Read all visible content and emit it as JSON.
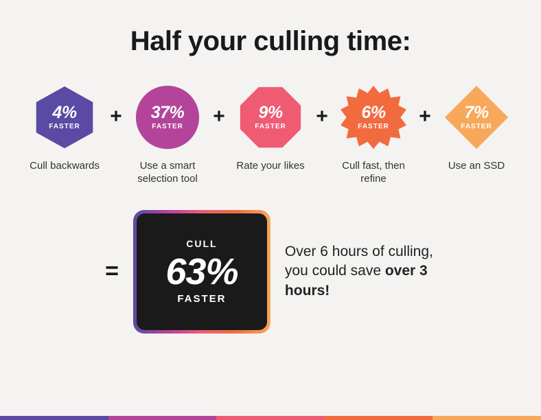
{
  "title": "Half your culling time:",
  "badges": [
    {
      "percent": "4%",
      "sub": "FASTER",
      "caption": "Cull backwards",
      "shape": "hexagon",
      "fill": "#5a4aa3"
    },
    {
      "percent": "37%",
      "sub": "FASTER",
      "caption": "Use a smart selection tool",
      "shape": "circle",
      "fill": "#b4449a"
    },
    {
      "percent": "9%",
      "sub": "FASTER",
      "caption": "Rate your likes",
      "shape": "octagon",
      "fill": "#ef5b72"
    },
    {
      "percent": "6%",
      "sub": "FASTER",
      "caption": "Cull fast, then refine",
      "shape": "burst",
      "fill": "#f26b3f"
    },
    {
      "percent": "7%",
      "sub": "FASTER",
      "caption": "Use an SSD",
      "shape": "diamond",
      "fill": "#f7a85a"
    }
  ],
  "plus": "+",
  "equals": "=",
  "result": {
    "top": "CULL",
    "percent": "63%",
    "bottom": "FASTER"
  },
  "summary": {
    "line1": "Over 6 hours of culling, you could save ",
    "bold": "over 3 hours!"
  },
  "stripe_colors": [
    "#5a4aa3",
    "#b4449a",
    "#ef5b72",
    "#f26b3f",
    "#f7a85a"
  ],
  "chart_data": {
    "type": "bar",
    "title": "Half your culling time:",
    "categories": [
      "Cull backwards",
      "Use a smart selection tool",
      "Rate your likes",
      "Cull fast, then refine",
      "Use an SSD"
    ],
    "values": [
      4,
      37,
      9,
      6,
      7
    ],
    "ylabel": "% faster",
    "total_label": "Cull faster",
    "total_value": 63,
    "note": "Over 6 hours of culling, you could save over 3 hours"
  }
}
